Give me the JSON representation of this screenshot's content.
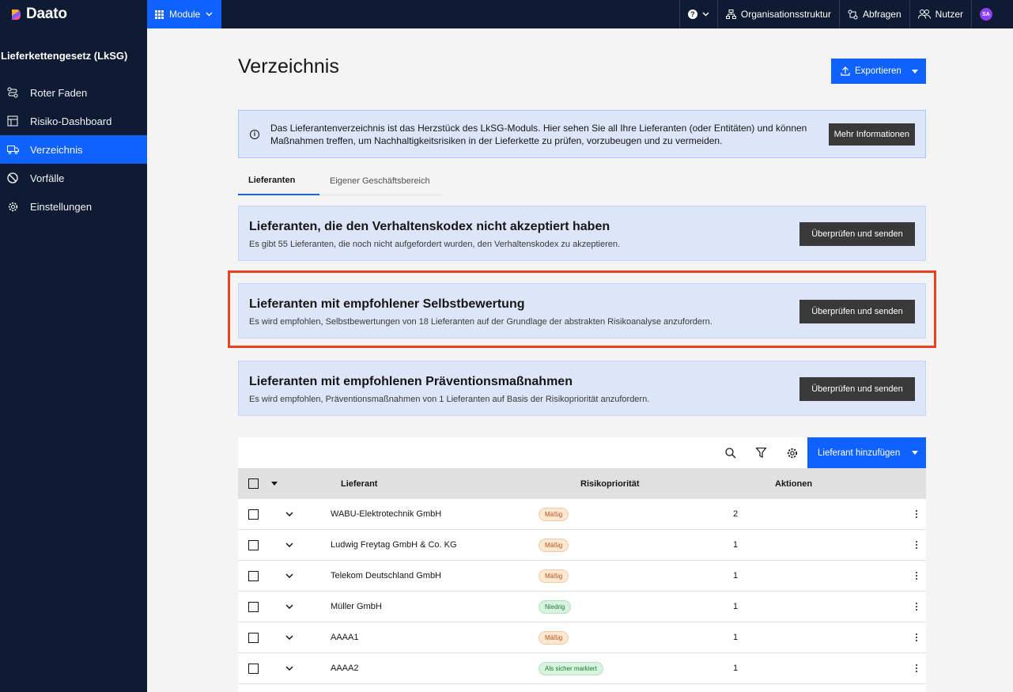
{
  "brand": {
    "name": "Daato"
  },
  "topbar": {
    "module_label": "Module",
    "help_label": "?",
    "org_label": "Organisationsstruktur",
    "requests_label": "Abfragen",
    "users_label": "Nutzer",
    "avatar_initials": "SA"
  },
  "sidebar": {
    "title": "Lieferkettengesetz (LkSG)",
    "items": [
      {
        "label": "Roter Faden",
        "icon": "route-icon"
      },
      {
        "label": "Risiko-Dashboard",
        "icon": "dashboard-icon"
      },
      {
        "label": "Verzeichnis",
        "icon": "truck-icon",
        "active": true
      },
      {
        "label": "Vorfälle",
        "icon": "blocked-icon"
      },
      {
        "label": "Einstellungen",
        "icon": "gear-icon"
      }
    ]
  },
  "page": {
    "title": "Verzeichnis",
    "export_label": "Exportieren"
  },
  "info": {
    "text": "Das Lieferantenverzeichnis ist das Herzstück des LkSG-Moduls. Hier sehen Sie all Ihre Lieferanten (oder Entitäten) und können Maßnahmen treffen, um Nachhaltigkeitsrisiken in der Lieferkette zu prüfen, vorzubeugen und zu vermeiden.",
    "button": "Mehr Informationen"
  },
  "tabs": [
    {
      "label": "Lieferanten",
      "active": true
    },
    {
      "label": "Eigener Geschäftsbereich",
      "active": false
    }
  ],
  "cards": [
    {
      "title": "Lieferanten, die den Verhaltenskodex nicht akzeptiert haben",
      "subtitle": "Es gibt 55 Lieferanten, die noch nicht aufgefordert wurden, den Verhaltenskodex zu akzeptieren.",
      "button": "Überprüfen und senden"
    },
    {
      "title": "Lieferanten mit empfohlener Selbstbewertung",
      "subtitle": "Es wird empfohlen, Selbstbewertungen von 18 Lieferanten auf der Grundlage der abstrakten Risikoanalyse anzufordern.",
      "button": "Überprüfen und senden"
    },
    {
      "title": "Lieferanten mit empfohlenen Präventionsmaßnahmen",
      "subtitle": "Es wird empfohlen, Präventionsmaßnahmen von 1 Lieferanten auf Basis der Risikopriorität anzufordern.",
      "button": "Überprüfen und senden"
    }
  ],
  "table": {
    "add_label": "Lieferant hinzufügen",
    "columns": {
      "supplier": "Lieferant",
      "risk": "Risikopriorität",
      "actions": "Aktionen"
    },
    "rows": [
      {
        "supplier": "WABU-Elektrotechnik GmbH",
        "risk": "Mäßig",
        "risk_type": "maessig",
        "actions": "2"
      },
      {
        "supplier": "Ludwig Freytag GmbH & Co. KG",
        "risk": "Mäßig",
        "risk_type": "maessig",
        "actions": "1"
      },
      {
        "supplier": "Telekom Deutschland GmbH",
        "risk": "Mäßig",
        "risk_type": "maessig",
        "actions": "1"
      },
      {
        "supplier": "Müller GmbH",
        "risk": "Niedrig",
        "risk_type": "niedrig",
        "actions": "1"
      },
      {
        "supplier": "AAAA1",
        "risk": "Mäßig",
        "risk_type": "maessig",
        "actions": "1"
      },
      {
        "supplier": "AAAA2",
        "risk": "Als sicher markiert",
        "risk_type": "sicher",
        "actions": "1"
      }
    ]
  },
  "colors": {
    "nav_bg": "#0e1b33",
    "primary": "#0f62fe",
    "card_bg": "#dce6f8",
    "highlight_border": "#e8431f",
    "badge_moderate": "#ffe8d2",
    "badge_low": "#d8f3de"
  }
}
